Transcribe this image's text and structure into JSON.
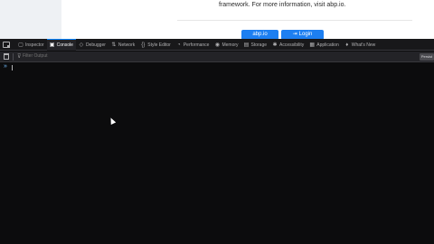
{
  "webpage": {
    "info_text": "framework. For more information, visit abp.io.",
    "buttons": [
      {
        "label": "abp.io"
      },
      {
        "label": "Login",
        "icon": "login-icon"
      }
    ]
  },
  "devtools": {
    "tabs": [
      {
        "label": "Inspector",
        "icon": "inspector-icon",
        "glyph": "▢"
      },
      {
        "label": "Console",
        "icon": "console-icon",
        "glyph": "▣",
        "active": true
      },
      {
        "label": "Debugger",
        "icon": "debugger-icon",
        "glyph": "◇"
      },
      {
        "label": "Network",
        "icon": "network-icon",
        "glyph": "⇅"
      },
      {
        "label": "Style Editor",
        "icon": "style-editor-icon",
        "glyph": "{}"
      },
      {
        "label": "Performance",
        "icon": "performance-icon",
        "glyph": "◔"
      },
      {
        "label": "Memory",
        "icon": "memory-icon",
        "glyph": "◉"
      },
      {
        "label": "Storage",
        "icon": "storage-icon",
        "glyph": "▤"
      },
      {
        "label": "Accessibility",
        "icon": "accessibility-icon",
        "glyph": "✱"
      },
      {
        "label": "Application",
        "icon": "application-icon",
        "glyph": "▦"
      },
      {
        "label": "What's New",
        "icon": "whats-new-icon",
        "glyph": "♦"
      }
    ],
    "filter_placeholder": "Filter Output",
    "persist_label": "Persist",
    "prompt": "»"
  },
  "colors": {
    "accent": "#0a84ff",
    "button": "#1d7ff1",
    "console_bg": "#0c0c0d",
    "toolbar_bg": "#18181a"
  }
}
